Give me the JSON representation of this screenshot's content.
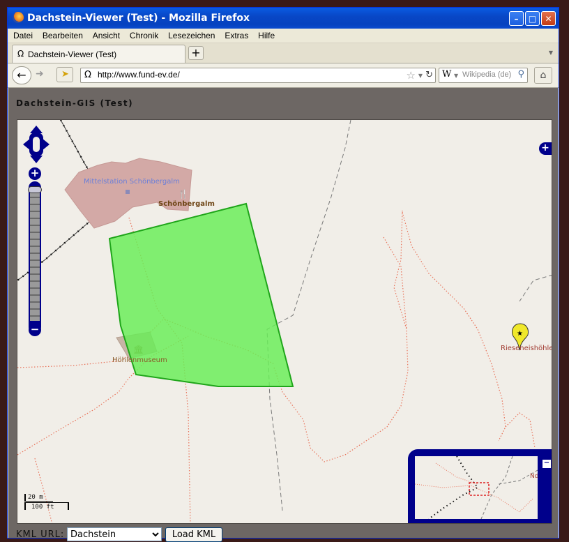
{
  "window": {
    "title": "Dachstein-Viewer (Test) - Mozilla Firefox"
  },
  "menu": [
    "Datei",
    "Bearbeiten",
    "Ansicht",
    "Chronik",
    "Lesezeichen",
    "Extras",
    "Hilfe"
  ],
  "tab": {
    "label": "Dachstein-Viewer (Test)",
    "icon": "omega-icon"
  },
  "urlbar": {
    "value": "http://www.fund-ev.de/"
  },
  "search": {
    "placeholder": "Wikipedia (de)"
  },
  "page": {
    "title": "Dachstein-GIS (Test)"
  },
  "map": {
    "labels": {
      "station": "Mittelstation Schönbergalm",
      "alm": "Schönbergalm",
      "museum": "Höhlenmuseum",
      "cave": "Rieseneishöhle"
    },
    "scale": {
      "metric": "20 m",
      "imperial": "100 ft"
    },
    "overview_label": "Nd",
    "polygon_color": "#66ee55"
  },
  "kml": {
    "label": "KML URL:",
    "selected": "Dachstein",
    "button": "Load KML"
  }
}
